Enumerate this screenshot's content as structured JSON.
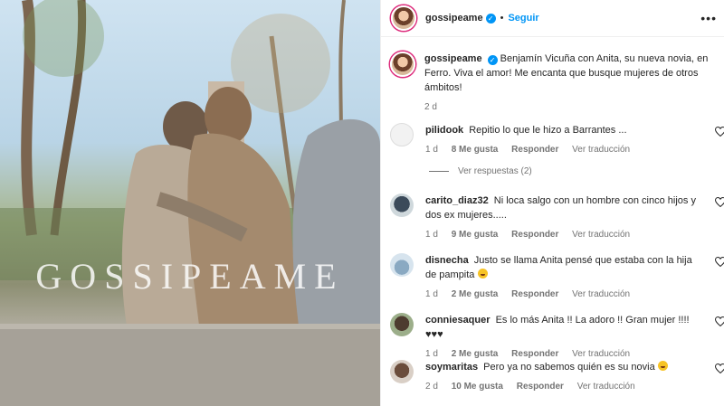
{
  "post": {
    "username": "gossipeame",
    "follow_label": "Seguir",
    "watermark": "GOSSIPEAME",
    "caption": "Benjamín Vicuña con Anita, su nueva novia, en Ferro. Viva el amor! Me encanta que busque mujeres de otros ámbitos!",
    "caption_age": "2 d"
  },
  "comments": [
    {
      "user": "pilidook",
      "text": "Repitio lo que le hizo a Barrantes ...",
      "age": "1 d",
      "likes": "8 Me gusta",
      "reply": "Responder",
      "translate": "Ver traducción"
    },
    {
      "user": "carito_diaz32",
      "text": "Ni loca salgo con un hombre con cinco hijos y dos ex mujeres.....",
      "age": "1 d",
      "likes": "9 Me gusta",
      "reply": "Responder",
      "translate": "Ver traducción"
    },
    {
      "user": "disnecha",
      "text": "Justo se llama Anita pensé que estaba con la hija de pampita",
      "age": "1 d",
      "likes": "2 Me gusta",
      "reply": "Responder",
      "translate": "Ver traducción"
    },
    {
      "user": "conniesaquer",
      "text": "Es lo más Anita !! La adoro !! Gran mujer !!!!♥♥♥",
      "age": "1 d",
      "likes": "2 Me gusta",
      "reply": "Responder",
      "translate": "Ver traducción"
    },
    {
      "user": "soymaritas",
      "text": "Pero ya no sabemos quién es su novia",
      "age": "2 d",
      "likes": "10 Me gusta",
      "reply": "Responder",
      "translate": "Ver traducción"
    }
  ],
  "view_replies": "Ver respuestas (2)",
  "colors": {
    "accent": "#0095f6",
    "muted": "#737373"
  }
}
